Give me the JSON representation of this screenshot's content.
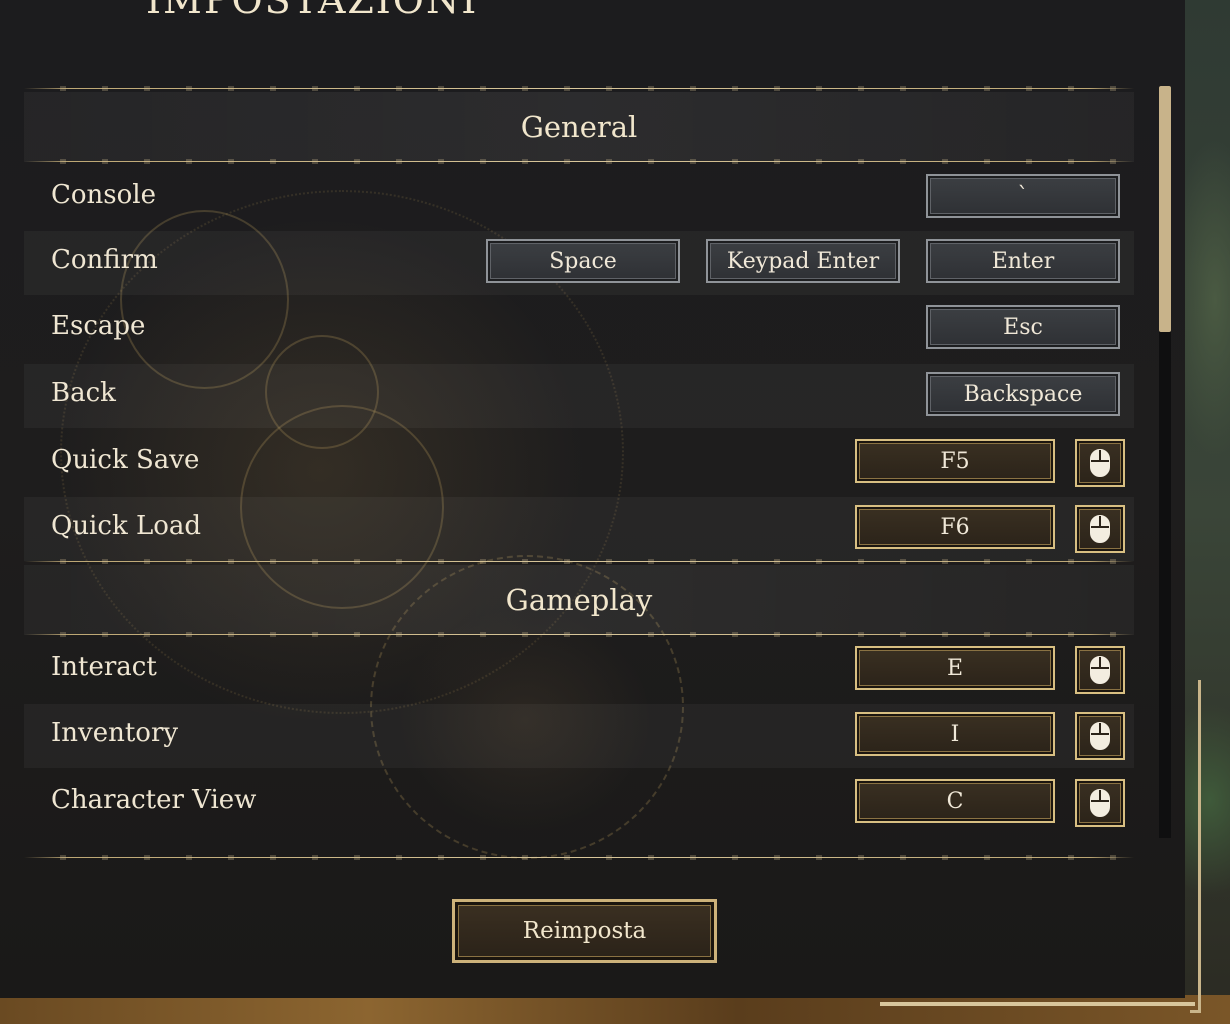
{
  "page_title": "IMPOSTAZIONI",
  "sections": [
    {
      "title": "General",
      "rows": [
        {
          "label": "Console",
          "keys": [
            "`"
          ]
        },
        {
          "label": "Confirm",
          "keys": [
            "Space",
            "Keypad Enter",
            "Enter"
          ]
        },
        {
          "label": "Escape",
          "keys": [
            "Esc"
          ]
        },
        {
          "label": "Back",
          "keys": [
            "Backspace"
          ]
        },
        {
          "label": "Quick Save",
          "keys": [
            "F5"
          ],
          "mouse_binding": "mouse-icon"
        },
        {
          "label": "Quick Load",
          "keys": [
            "F6"
          ],
          "mouse_binding": "mouse-icon"
        }
      ]
    },
    {
      "title": "Gameplay",
      "rows": [
        {
          "label": "Interact",
          "keys": [
            "E"
          ],
          "mouse_binding": "mouse-icon"
        },
        {
          "label": "Inventory",
          "keys": [
            "I"
          ],
          "mouse_binding": "mouse-icon"
        },
        {
          "label": "Character View",
          "keys": [
            "C"
          ],
          "mouse_binding": "mouse-icon"
        }
      ]
    }
  ],
  "reset_label": "Reimposta",
  "colors": {
    "accent_gold": "#d8bf82",
    "key_border_silver": "#8f9398",
    "panel_bg": "#1c1c1e",
    "text": "#efe6d2"
  }
}
